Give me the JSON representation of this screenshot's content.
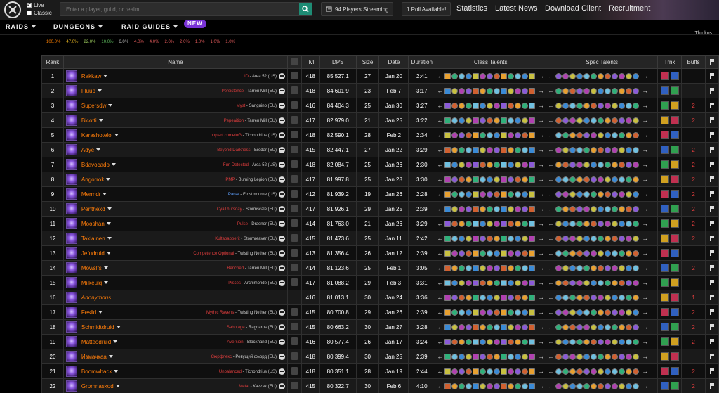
{
  "topbar": {
    "modes": [
      {
        "label": "Live",
        "checked": true
      },
      {
        "label": "Classic",
        "checked": false
      }
    ],
    "search_placeholder": "Enter a player, guild, or realm",
    "streaming_label": "94 Players Streaming",
    "poll_label": "1 Poll Available!",
    "nav": [
      "Statistics",
      "Latest News",
      "Download Client",
      "Recruitment"
    ]
  },
  "subnav": {
    "items": [
      "RAIDS",
      "DUNGEONS",
      "RAID GUIDES"
    ],
    "new_badge": "NEW"
  },
  "percent_strip": [
    "100.0%",
    "47.0%",
    "22.0%",
    "10.0%",
    "6.0%",
    "4.0%",
    "4.0%",
    "2.0%",
    "2.0%",
    "1.0%",
    "1.0%",
    "1.0%"
  ],
  "percent_colors": [
    "#ff8000",
    "#e0b020",
    "#a0d060",
    "#60c060",
    "#c0c0c0",
    "#e05a5a",
    "#e05a5a",
    "#e05a5a",
    "#e05a5a",
    "#e05a5a",
    "#e05a5a",
    "#e05a5a"
  ],
  "corner_text": "Thinkos",
  "table": {
    "headers": {
      "rank": "Rank",
      "name": "Name",
      "ilvl": "Ilvl",
      "dps": "DPS",
      "size": "Size",
      "date": "Date",
      "duration": "Duration",
      "class_talents": "Class Talents",
      "spec_talents": "Spec Talents",
      "trnk": "Trnk",
      "buffs": "Buffs"
    },
    "rows": [
      {
        "rank": "1",
        "name": "Rakkaw",
        "guild": "iD",
        "realm": "Area 52 (US)",
        "ilvl": "418",
        "dps": "85,527.1",
        "size": "27",
        "date": "Jan 20",
        "duration": "2:41",
        "buffs": ""
      },
      {
        "rank": "2",
        "name": "Fluup",
        "guild": "Persistence",
        "realm": "Tarren Mill (EU)",
        "ilvl": "418",
        "dps": "84,601.9",
        "size": "23",
        "date": "Feb 7",
        "duration": "3:17",
        "buffs": ""
      },
      {
        "rank": "3",
        "name": "Supersdw",
        "guild": "Myst",
        "realm": "Sanguino (EU)",
        "ilvl": "416",
        "dps": "84,404.3",
        "size": "25",
        "date": "Jan 30",
        "duration": "3:27",
        "buffs": "2"
      },
      {
        "rank": "4",
        "name": "Bicotti",
        "guild": "Pepeaition",
        "realm": "Tarren Mill (EU)",
        "ilvl": "417",
        "dps": "82,979.0",
        "size": "21",
        "date": "Jan 25",
        "duration": "3:22",
        "buffs": "2"
      },
      {
        "rank": "5",
        "name": "Karashotelol",
        "guild": "poplart cometoG",
        "realm": "Tichondrius (US)",
        "ilvl": "418",
        "dps": "82,590.1",
        "size": "28",
        "date": "Feb 2",
        "duration": "2:34",
        "buffs": ""
      },
      {
        "rank": "6",
        "name": "Adye",
        "guild": "Beyond Darkness",
        "realm": "Eredar (EU)",
        "ilvl": "415",
        "dps": "82,447.1",
        "size": "27",
        "date": "Jan 22",
        "duration": "3:29",
        "buffs": "2"
      },
      {
        "rank": "7",
        "name": "Bdavocado",
        "guild": "Fun Detected",
        "realm": "Area 52 (US)",
        "ilvl": "418",
        "dps": "82,084.7",
        "size": "25",
        "date": "Jan 26",
        "duration": "2:30",
        "buffs": "2"
      },
      {
        "rank": "8",
        "name": "Angorrok",
        "guild": "PMP",
        "realm": "Burning Legion (EU)",
        "ilvl": "417",
        "dps": "81,997.8",
        "size": "25",
        "date": "Jan 28",
        "duration": "3:30",
        "buffs": "2"
      },
      {
        "rank": "9",
        "name": "Mermdr",
        "guild": "Parse",
        "realm": "Frostmourne (US)",
        "ilvl": "412",
        "dps": "81,939.2",
        "size": "19",
        "date": "Jan 26",
        "duration": "2:28",
        "buffs": "2",
        "guild_blue": true
      },
      {
        "rank": "10",
        "name": "Penthexd",
        "guild": "CyaThursday",
        "realm": "Stormscale (EU)",
        "ilvl": "417",
        "dps": "81,926.1",
        "size": "29",
        "date": "Jan 25",
        "duration": "2:39",
        "buffs": "2"
      },
      {
        "rank": "11",
        "name": "Mooshán",
        "guild": "Pulse",
        "realm": "Draenor (EU)",
        "ilvl": "414",
        "dps": "81,763.0",
        "size": "21",
        "date": "Jan 26",
        "duration": "3:29",
        "buffs": "2"
      },
      {
        "rank": "12",
        "name": "Taklainen",
        "guild": "Kultapapperit",
        "realm": "Stormreaver (EU)",
        "ilvl": "415",
        "dps": "81,473.6",
        "size": "25",
        "date": "Jan 11",
        "duration": "2:42",
        "buffs": "2"
      },
      {
        "rank": "13",
        "name": "Jefudruid",
        "guild": "Competence Optional",
        "realm": "Twisting Nether (EU)",
        "ilvl": "413",
        "dps": "81,356.4",
        "size": "26",
        "date": "Jan 12",
        "duration": "2:39",
        "buffs": ""
      },
      {
        "rank": "14",
        "name": "Mowslfs",
        "guild": "Benched",
        "realm": "Tarren Mill (EU)",
        "ilvl": "414",
        "dps": "81,123.6",
        "size": "25",
        "date": "Feb 1",
        "duration": "3:05",
        "buffs": "2"
      },
      {
        "rank": "15",
        "name": "Miikeulq",
        "guild": "Pisces",
        "realm": "Archimonde (EU)",
        "ilvl": "417",
        "dps": "81,088.2",
        "size": "29",
        "date": "Feb 3",
        "duration": "3:31",
        "buffs": ""
      },
      {
        "rank": "16",
        "name": "Anonymous",
        "guild": "",
        "realm": "",
        "ilvl": "416",
        "dps": "81,013.1",
        "size": "30",
        "date": "Jan 24",
        "duration": "3:36",
        "buffs": "1",
        "anonymous": true
      },
      {
        "rank": "17",
        "name": "Feslld",
        "guild": "Mythic Ravens",
        "realm": "Twisting Nether (EU)",
        "ilvl": "415",
        "dps": "80,700.8",
        "size": "29",
        "date": "Jan 26",
        "duration": "2:39",
        "buffs": "2"
      },
      {
        "rank": "18",
        "name": "Schmidtdruid",
        "guild": "Sabotage",
        "realm": "Ragnaros (EU)",
        "ilvl": "415",
        "dps": "80,663.2",
        "size": "30",
        "date": "Jan 27",
        "duration": "3:28",
        "buffs": "2"
      },
      {
        "rank": "19",
        "name": "Matteodruid",
        "guild": "Aversion",
        "realm": "Blackhand (EU)",
        "ilvl": "416",
        "dps": "80,577.4",
        "size": "26",
        "date": "Jan 17",
        "duration": "3:24",
        "buffs": "2"
      },
      {
        "rank": "20",
        "name": "Измачкаа",
        "guild": "Сюрфлекс",
        "realm": "Ревущий фьорд (EU)",
        "ilvl": "418",
        "dps": "80,399.4",
        "size": "30",
        "date": "Jan 25",
        "duration": "2:39",
        "buffs": ""
      },
      {
        "rank": "21",
        "name": "Boomwhack",
        "guild": "Unbalanced",
        "realm": "Tichondrius (US)",
        "ilvl": "418",
        "dps": "80,351.1",
        "size": "28",
        "date": "Jan 19",
        "duration": "2:44",
        "buffs": "2"
      },
      {
        "rank": "22",
        "name": "Gromnaskod",
        "guild": "Metal",
        "realm": "Kazzak (EU)",
        "ilvl": "415",
        "dps": "80,322.7",
        "size": "30",
        "date": "Feb 6",
        "duration": "4:10",
        "buffs": "2"
      }
    ]
  },
  "icon_palette": [
    "#e8a030",
    "#3a8ad6",
    "#8a5ad8",
    "#2fb07a",
    "#c8c040",
    "#d06030",
    "#6fc0e0",
    "#b040b0"
  ],
  "trinket_palette": [
    "#c03050",
    "#3060c0",
    "#30a050",
    "#d0a020"
  ]
}
